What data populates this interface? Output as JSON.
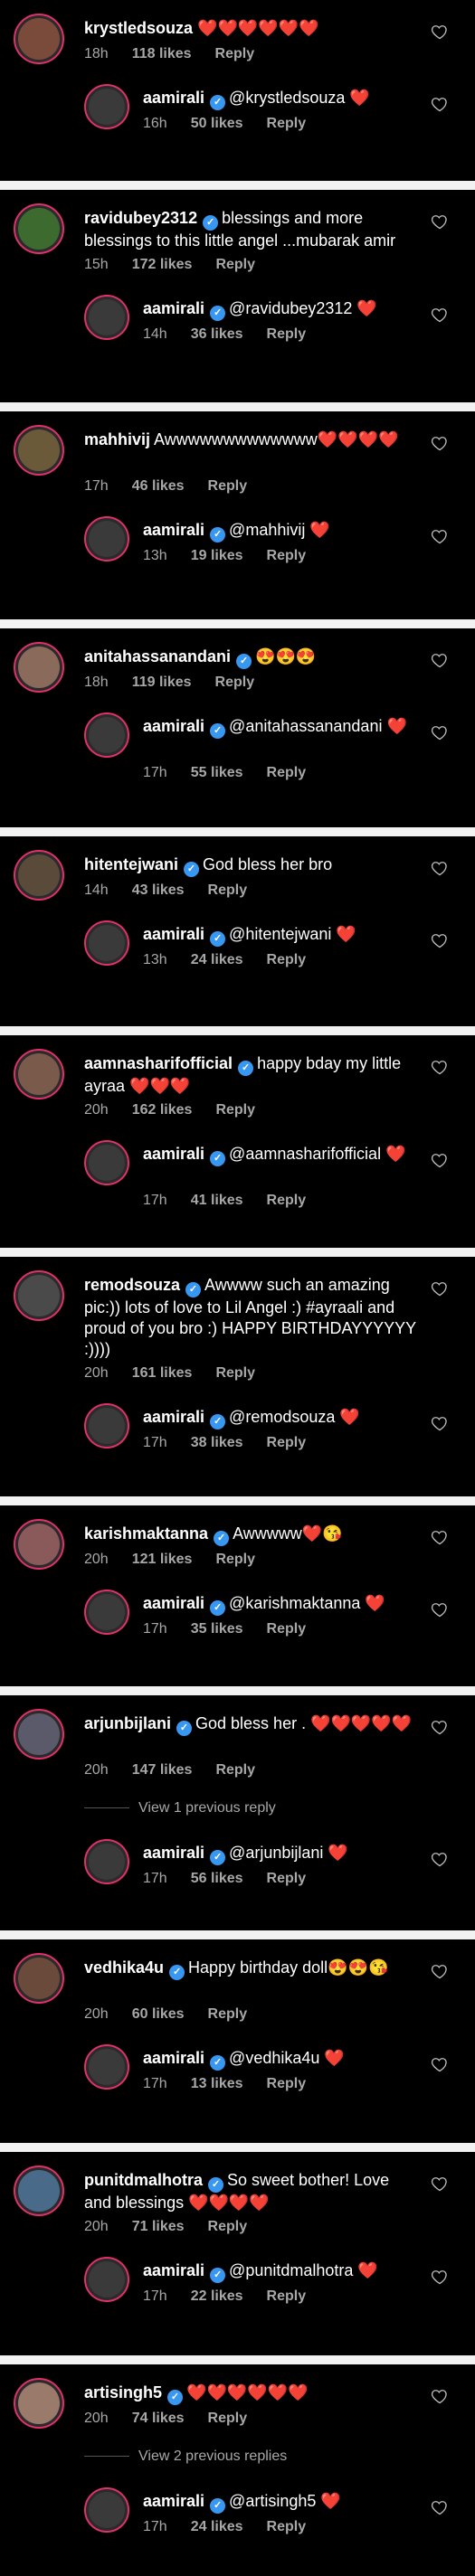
{
  "owner_reply_prefix": "aamirali",
  "comments": [
    {
      "user": "krystledsouza",
      "verified": false,
      "text": "❤️❤️❤️❤️❤️❤️",
      "time": "18h",
      "likes": "118 likes",
      "reply": "Reply",
      "reply_user": "aamirali",
      "reply_text": "@krystledsouza ❤️",
      "reply_time": "16h",
      "reply_likes": "50 likes",
      "reply_reply": "Reply"
    },
    {
      "user": "ravidubey2312",
      "verified": true,
      "text": "blessings and more blessings to this little angel ...mubarak amir",
      "time": "15h",
      "likes": "172 likes",
      "reply": "Reply",
      "reply_user": "aamirali",
      "reply_text": "@ravidubey2312 ❤️",
      "reply_time": "14h",
      "reply_likes": "36 likes",
      "reply_reply": "Reply"
    },
    {
      "user": "mahhivij",
      "verified": false,
      "text": "Awwwwwwwwwwwww❤️❤️❤️❤️",
      "time": "17h",
      "likes": "46 likes",
      "reply": "Reply",
      "reply_user": "aamirali",
      "reply_text": "@mahhivij ❤️",
      "reply_time": "13h",
      "reply_likes": "19 likes",
      "reply_reply": "Reply"
    },
    {
      "user": "anitahassanandani",
      "verified": true,
      "text": "😍😍😍",
      "time": "18h",
      "likes": "119 likes",
      "reply": "Reply",
      "reply_user": "aamirali",
      "reply_text": "@anitahassanandani ❤️",
      "reply_time": "17h",
      "reply_likes": "55 likes",
      "reply_reply": "Reply"
    },
    {
      "user": "hitentejwani",
      "verified": true,
      "text": "God bless her bro",
      "time": "14h",
      "likes": "43 likes",
      "reply": "Reply",
      "reply_user": "aamirali",
      "reply_text": "@hitentejwani ❤️",
      "reply_time": "13h",
      "reply_likes": "24 likes",
      "reply_reply": "Reply"
    },
    {
      "user": "aamnasharifofficial",
      "verified": true,
      "text": "happy bday my little ayraa ❤️❤️❤️",
      "time": "20h",
      "likes": "162 likes",
      "reply": "Reply",
      "reply_user": "aamirali",
      "reply_text": "@aamnasharifofficial ❤️",
      "reply_time": "17h",
      "reply_likes": "41 likes",
      "reply_reply": "Reply"
    },
    {
      "user": "remodsouza",
      "verified": true,
      "text": "Awwww such an amazing pic:)) lots of love to Lil Angel :) #ayraali and proud of you bro :) HAPPY BIRTHDAYYYYYY :))))",
      "time": "20h",
      "likes": "161 likes",
      "reply": "Reply",
      "reply_user": "aamirali",
      "reply_text": "@remodsouza ❤️",
      "reply_time": "17h",
      "reply_likes": "38 likes",
      "reply_reply": "Reply"
    },
    {
      "user": "karishmaktanna",
      "verified": true,
      "text": "Awwwww❤️😘",
      "time": "20h",
      "likes": "121 likes",
      "reply": "Reply",
      "reply_user": "aamirali",
      "reply_text": "@karishmaktanna ❤️",
      "reply_time": "17h",
      "reply_likes": "35 likes",
      "reply_reply": "Reply"
    },
    {
      "user": "arjunbijlani",
      "verified": true,
      "text": "God bless her . ❤️❤️❤️❤️❤️",
      "time": "20h",
      "likes": "147 likes",
      "reply": "Reply",
      "view_more": "View 1 previous reply",
      "reply_user": "aamirali",
      "reply_text": "@arjunbijlani ❤️",
      "reply_time": "17h",
      "reply_likes": "56 likes",
      "reply_reply": "Reply"
    },
    {
      "user": "vedhika4u",
      "verified": true,
      "text": "Happy birthday doll😍😍😘",
      "time": "20h",
      "likes": "60 likes",
      "reply": "Reply",
      "reply_user": "aamirali",
      "reply_text": "@vedhika4u ❤️",
      "reply_time": "17h",
      "reply_likes": "13 likes",
      "reply_reply": "Reply"
    },
    {
      "user": "punitdmalhotra",
      "verified": true,
      "text": "So sweet bother! Love and blessings ❤️❤️❤️❤️",
      "time": "20h",
      "likes": "71 likes",
      "reply": "Reply",
      "reply_user": "aamirali",
      "reply_text": "@punitdmalhotra ❤️",
      "reply_time": "17h",
      "reply_likes": "22 likes",
      "reply_reply": "Reply"
    },
    {
      "user": "artisingh5",
      "verified": true,
      "text": "❤️❤️❤️❤️❤️❤️",
      "time": "20h",
      "likes": "74 likes",
      "reply": "Reply",
      "view_more": "View 2 previous replies",
      "reply_user": "aamirali",
      "reply_text": "@artisingh5 ❤️",
      "reply_time": "17h",
      "reply_likes": "24 likes",
      "reply_reply": "Reply"
    }
  ],
  "colors": {
    "background": "#000000",
    "separator": "#f2f2f2",
    "verified": "#3897f0",
    "muted": "#a8a8a8",
    "story_ring": "#e1306c"
  },
  "icons": {
    "like": "heart-outline-icon",
    "verified": "verified-badge-icon"
  }
}
